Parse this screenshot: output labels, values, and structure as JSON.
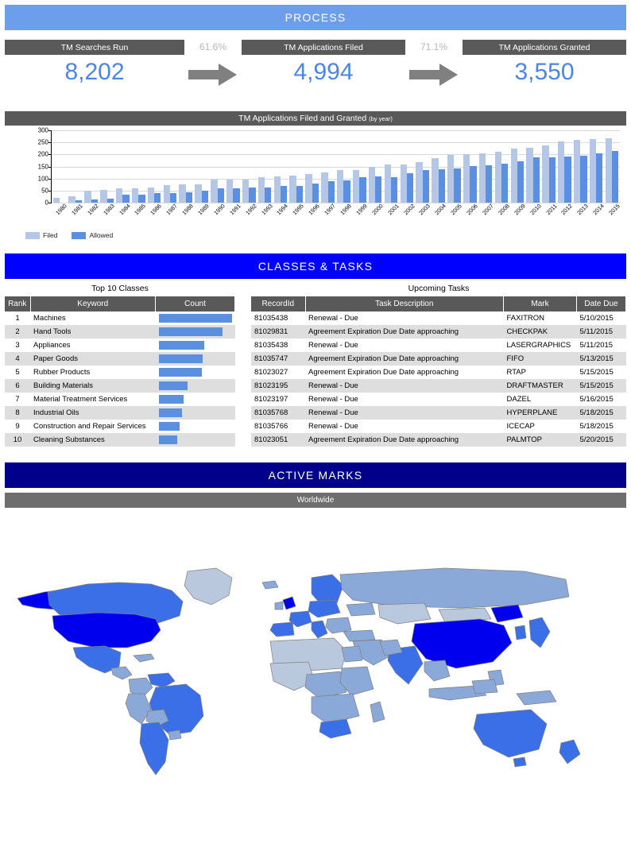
{
  "process": {
    "band_title": "PROCESS",
    "kpis": [
      {
        "label": "TM Searches Run",
        "value": "8,202"
      },
      {
        "label": "TM Applications Filed",
        "value": "4,994"
      },
      {
        "label": "TM Applications Granted",
        "value": "3,550"
      }
    ],
    "connectors": [
      {
        "pct": "61.6%",
        "icon": "arrow-right-icon"
      },
      {
        "pct": "71.1%",
        "icon": "arrow-right-icon"
      }
    ]
  },
  "chart_data": {
    "type": "bar",
    "title": "TM Applications Filed and Granted",
    "subtitle": "(by year)",
    "xlabel": "",
    "ylabel": "",
    "ylim": [
      0,
      300
    ],
    "yticks": [
      0,
      50,
      100,
      150,
      200,
      250,
      300
    ],
    "grid": true,
    "legend_position": "bottom-left",
    "categories": [
      "1980",
      "1981",
      "1982",
      "1983",
      "1984",
      "1985",
      "1986",
      "1987",
      "1988",
      "1989",
      "1990",
      "1991",
      "1992",
      "1993",
      "1994",
      "1995",
      "1996",
      "1997",
      "1998",
      "1999",
      "2000",
      "2001",
      "2002",
      "2003",
      "2004",
      "2005",
      "2006",
      "2007",
      "2008",
      "2009",
      "2010",
      "2011",
      "2012",
      "2013",
      "2014",
      "2015"
    ],
    "series": [
      {
        "name": "Filed",
        "color": "#b4c7e7",
        "values": [
          19,
          26,
          48,
          54,
          58,
          61,
          64,
          73,
          76,
          77,
          95,
          95,
          95,
          105,
          109,
          111,
          118,
          124,
          135,
          135,
          150,
          157,
          157,
          167,
          185,
          199,
          200,
          204,
          211,
          224,
          226,
          239,
          255,
          260,
          264,
          268
        ]
      },
      {
        "name": "Allowed",
        "color": "#5b8fe0",
        "values": [
          0,
          10,
          13,
          16,
          32,
          32,
          38,
          39,
          42,
          49,
          58,
          61,
          64,
          64,
          70,
          69,
          79,
          88,
          91,
          104,
          108,
          107,
          121,
          134,
          137,
          143,
          153,
          156,
          163,
          172,
          188,
          188,
          192,
          195,
          204,
          213
        ]
      }
    ]
  },
  "classes_tasks": {
    "band_title": "CLASSES & TASKS",
    "top_classes": {
      "caption": "Top 10 Classes",
      "columns": [
        "Rank",
        "Keyword",
        "Count"
      ],
      "rows": [
        {
          "rank": "1",
          "keyword": "Machines",
          "count_pct": 100
        },
        {
          "rank": "2",
          "keyword": "Hand Tools",
          "count_pct": 88
        },
        {
          "rank": "3",
          "keyword": "Appliances",
          "count_pct": 62
        },
        {
          "rank": "4",
          "keyword": "Paper Goods",
          "count_pct": 60
        },
        {
          "rank": "5",
          "keyword": "Rubber Products",
          "count_pct": 59
        },
        {
          "rank": "6",
          "keyword": "Building Materials",
          "count_pct": 40
        },
        {
          "rank": "7",
          "keyword": "Material Treatment Services",
          "count_pct": 34
        },
        {
          "rank": "8",
          "keyword": "Industrial Oils",
          "count_pct": 32
        },
        {
          "rank": "9",
          "keyword": "Construction and Repair Services",
          "count_pct": 29
        },
        {
          "rank": "10",
          "keyword": "Cleaning Substances",
          "count_pct": 25
        }
      ]
    },
    "upcoming_tasks": {
      "caption": "Upcoming Tasks",
      "columns": [
        "RecordId",
        "Task Description",
        "Mark",
        "Date Due"
      ],
      "rows": [
        {
          "record_id": "81035438",
          "description": "Renewal -  Due",
          "mark": "FAXITRON",
          "date_due": "5/10/2015"
        },
        {
          "record_id": "81029831",
          "description": "Agreement Expiration Due Date approaching",
          "mark": "CHECKPAK",
          "date_due": "5/11/2015"
        },
        {
          "record_id": "81035438",
          "description": "Renewal -  Due",
          "mark": "LASERGRAPHICS",
          "date_due": "5/11/2015"
        },
        {
          "record_id": "81035747",
          "description": "Agreement Expiration Due Date approaching",
          "mark": "FIFO",
          "date_due": "5/13/2015"
        },
        {
          "record_id": "81023027",
          "description": "Agreement Expiration Due Date approaching",
          "mark": "RTAP",
          "date_due": "5/15/2015"
        },
        {
          "record_id": "81023195",
          "description": "Renewal -  Due",
          "mark": "DRAFTMASTER",
          "date_due": "5/15/2015"
        },
        {
          "record_id": "81023197",
          "description": "Renewal -  Due",
          "mark": "DAZEL",
          "date_due": "5/16/2015"
        },
        {
          "record_id": "81035768",
          "description": "Renewal -  Due",
          "mark": "HYPERPLANE",
          "date_due": "5/18/2015"
        },
        {
          "record_id": "81035766",
          "description": "Renewal -  Due",
          "mark": "ICECAP",
          "date_due": "5/18/2015"
        },
        {
          "record_id": "81023051",
          "description": "Agreement Expiration Due Date approaching",
          "mark": "PALMTOP",
          "date_due": "5/20/2015"
        }
      ]
    }
  },
  "active_marks": {
    "band_title": "ACTIVE MARKS",
    "scope_label": "Worldwide",
    "map_type": "choropleth"
  },
  "colors": {
    "process_band": "#6d9eeb",
    "classes_band": "#0000ff",
    "marks_band": "#00008b",
    "header_grey": "#595959",
    "kpi_value_blue": "#4a86e8",
    "pct_grey": "#b7b7b7",
    "bar_filed": "#b4c7e7",
    "bar_allowed": "#5b8fe0",
    "row_alt": "#dedede",
    "map_high": "#0000ee",
    "map_mid": "#3b6fe8",
    "map_low": "#8aa8d8",
    "map_lowest": "#b9c8dd"
  }
}
